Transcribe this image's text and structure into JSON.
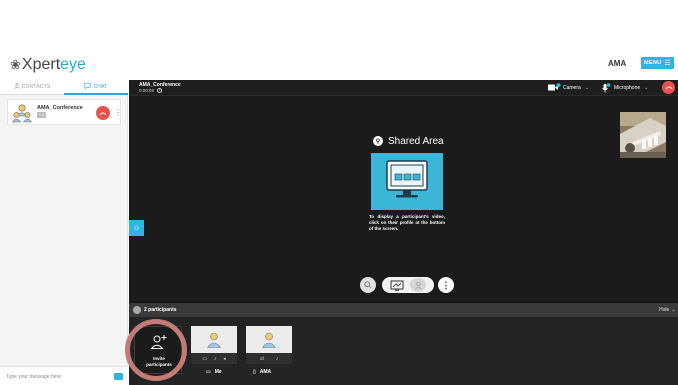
{
  "header": {
    "logo_mark": "❀",
    "logo_part1": "Xpert",
    "logo_part2": "eye",
    "username": "AMA",
    "menu_label": "MENU",
    "menu_icon": "hamburger-icon"
  },
  "sidebar": {
    "tabs": [
      {
        "label": "CONTACTS",
        "icon": "person-icon",
        "active": false
      },
      {
        "label": "CHAT",
        "icon": "chat-icon",
        "active": true
      }
    ],
    "conversation": {
      "name": "AMA_Conference",
      "count": "2"
    },
    "message_placeholder": "Type your message here"
  },
  "conference": {
    "title": "AMA_Conference",
    "timer": "0:00:08",
    "camera_label": "Camera",
    "microphone_label": "Microphone",
    "shared_area_title": "Shared Area",
    "shared_area_hint": "To display a participant's video, click on their profile at the bottom of the screen."
  },
  "participants": {
    "count_label": "2 participants",
    "hide_label": "Hide",
    "invite_label_line1": "Invite",
    "invite_label_line2": "participants",
    "members": [
      {
        "name": "Me"
      },
      {
        "name": "AMA"
      }
    ]
  },
  "colors": {
    "accent": "#2fb5e2",
    "hangup": "#e8514c",
    "shared_illustration": "#3cb6d8"
  }
}
